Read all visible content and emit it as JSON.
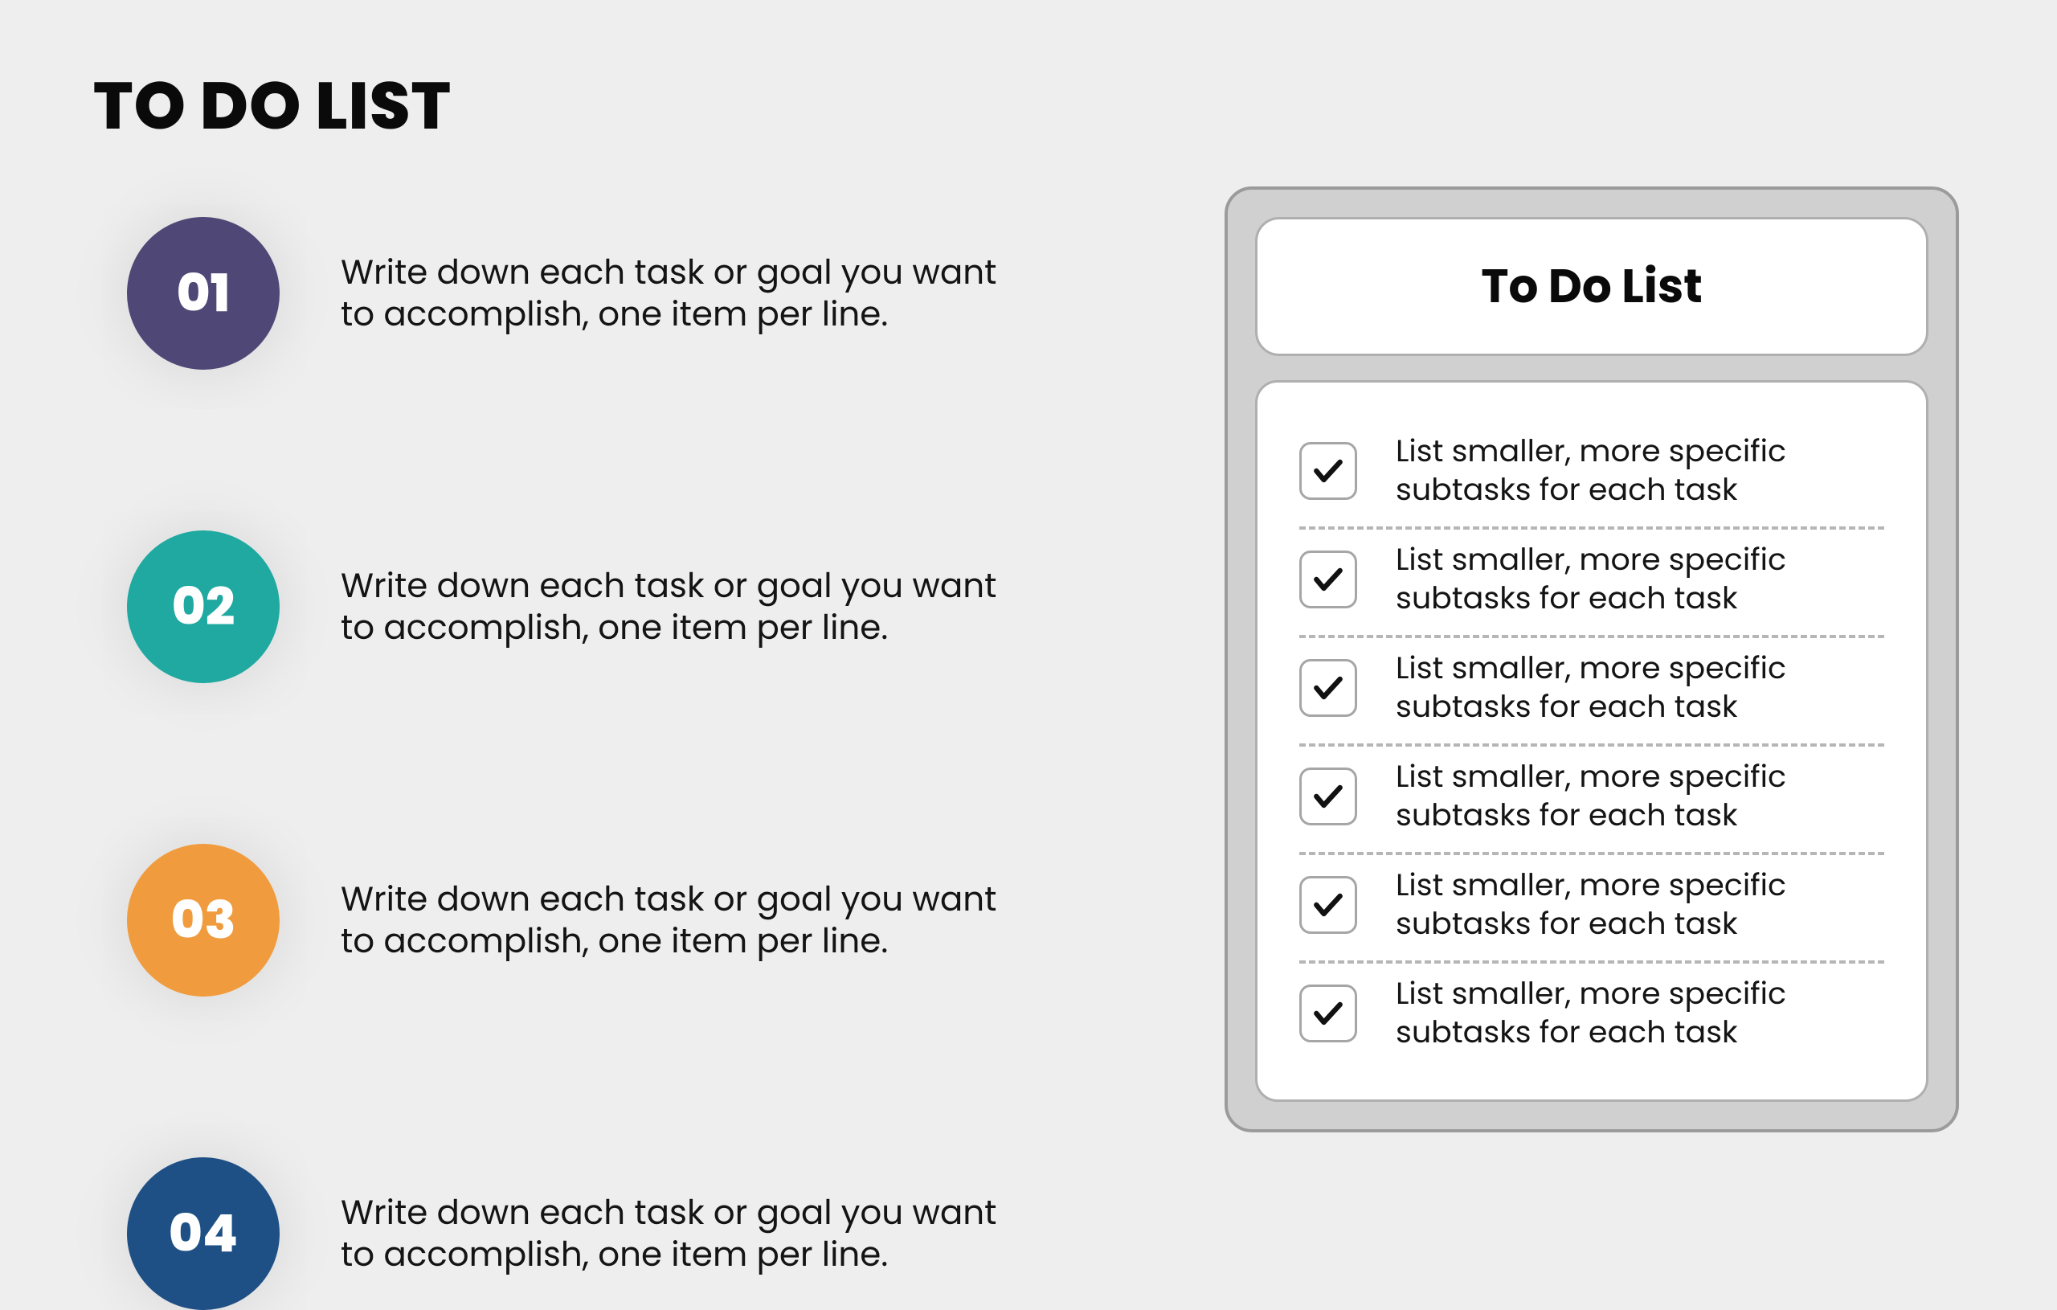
{
  "title": "TO DO LIST",
  "steps": [
    {
      "num": "01",
      "color": "#4f4776",
      "text": "Write down each task or goal you want to accomplish, one item per line."
    },
    {
      "num": "02",
      "color": "#20a9a1",
      "text": "Write down each task or goal you want to accomplish, one item per line."
    },
    {
      "num": "03",
      "color": "#f09c3e",
      "text": "Write down each task or goal you want to accomplish, one item per line."
    },
    {
      "num": "04",
      "color": "#1e5085",
      "text": "Write down each task or goal you want to accomplish, one item per line."
    }
  ],
  "card": {
    "title": "To Do List",
    "items": [
      "List smaller, more specific subtasks for each task",
      "List smaller, more specific subtasks for each task",
      "List smaller, more specific subtasks for each task",
      "List smaller, more specific subtasks for each task",
      "List smaller, more specific subtasks for each task",
      "List smaller, more specific subtasks for each task"
    ]
  }
}
